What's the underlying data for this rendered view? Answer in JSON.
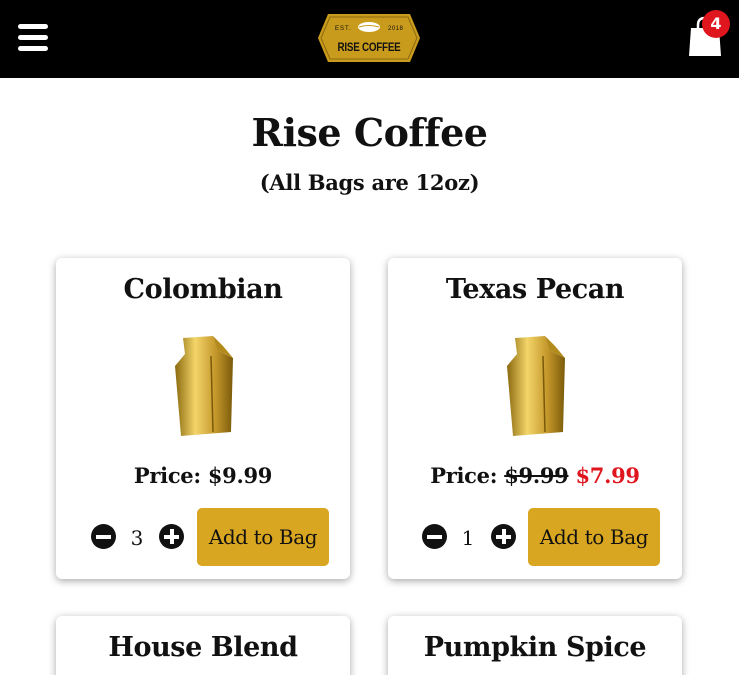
{
  "header": {
    "logo": {
      "est": "EST.",
      "year": "2018",
      "name": "RISE COFFEE",
      "color": "#c99b1c"
    },
    "cart_count": "4",
    "badge_color": "#e0161f"
  },
  "page": {
    "title": "Rise Coffee",
    "subtitle": "(All Bags are 12oz)"
  },
  "products": [
    {
      "name": "Colombian",
      "price_label": "Price:",
      "price": "$9.99",
      "quantity": "3",
      "button": "Add to Bag"
    },
    {
      "name": "Texas Pecan",
      "price_label": "Price:",
      "price": "$9.99",
      "sale_price": "$7.99",
      "quantity": "1",
      "button": "Add to Bag"
    },
    {
      "name": "House Blend"
    },
    {
      "name": "Pumpkin Spice"
    }
  ],
  "colors": {
    "accent": "#d9a621",
    "sale": "#e0161f",
    "header_bg": "#000000"
  }
}
